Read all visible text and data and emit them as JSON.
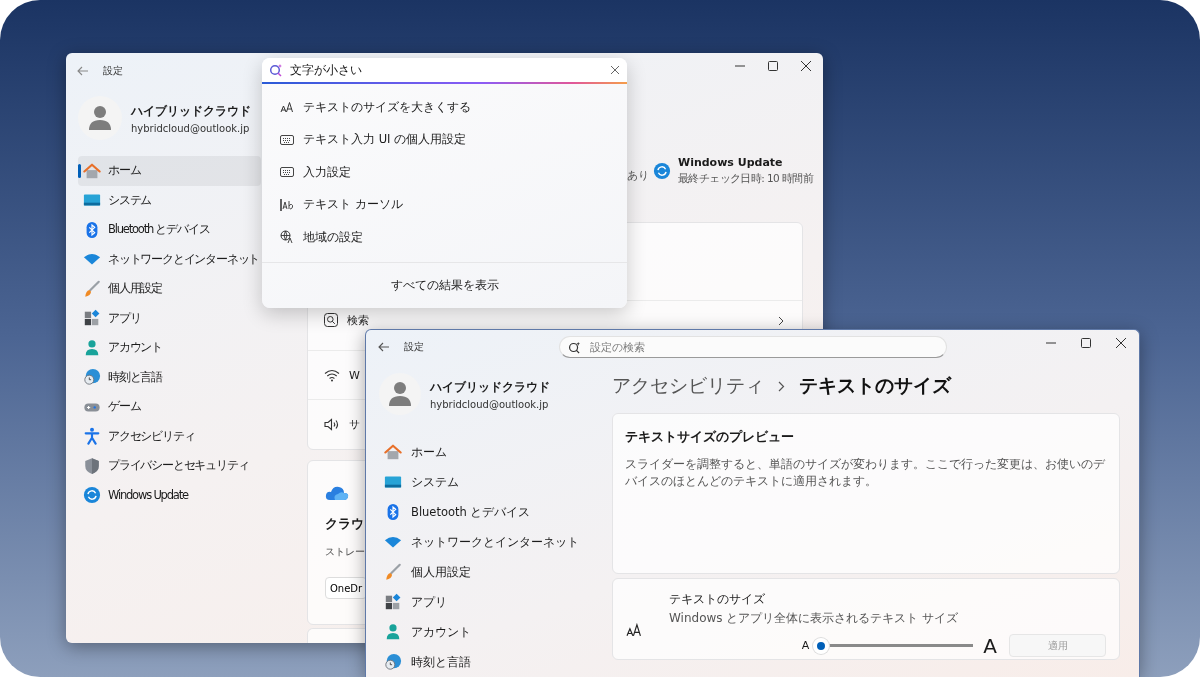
{
  "background_window": {
    "title": "設定",
    "search": {
      "value": "文字が小さい",
      "suggestions": [
        {
          "kind": "text-size",
          "label": "テキストのサイズを大きくする"
        },
        {
          "kind": "keyboard",
          "label": "テキスト入力 UI の個人用設定"
        },
        {
          "kind": "keyboard",
          "label": "入力設定"
        },
        {
          "kind": "cursor",
          "label": "テキスト カーソル"
        },
        {
          "kind": "region",
          "label": "地域の設定"
        }
      ],
      "show_all": "すべての結果を表示"
    },
    "profile": {
      "name": "ハイブリッドクラウド",
      "email": "hybridcloud@outlook.jp"
    },
    "nav": [
      {
        "label": "ホーム",
        "selected": true
      },
      {
        "label": "システム",
        "selected": false
      },
      {
        "label": "Bluetooth とデバイス",
        "selected": false
      },
      {
        "label": "ネットワークとインターネット",
        "selected": false
      },
      {
        "label": "個人用設定",
        "selected": false
      },
      {
        "label": "アプリ",
        "selected": false
      },
      {
        "label": "アカウント",
        "selected": false
      },
      {
        "label": "時刻と言語",
        "selected": false
      },
      {
        "label": "ゲーム",
        "selected": false
      },
      {
        "label": "アクセシビリティ",
        "selected": false
      },
      {
        "label": "プライバシーとセキュリティ",
        "selected": false
      },
      {
        "label": "Windows Update",
        "selected": false
      }
    ],
    "status_fragment": "あり",
    "update_tile": {
      "title": "Windows Update",
      "subtitle": "最終チェック日時: 10 時間前"
    },
    "rows": [
      {
        "kind": "search",
        "label": "検索"
      },
      {
        "kind": "wifi",
        "label": "W"
      },
      {
        "kind": "sound",
        "label": "サ"
      }
    ],
    "cloud_card": {
      "title": "クラウ",
      "text": "ストレー",
      "button": "OneDr"
    }
  },
  "front_window": {
    "title": "設定",
    "search": {
      "placeholder": "設定の検索"
    },
    "profile": {
      "name": "ハイブリッドクラウド",
      "email": "hybridcloud@outlook.jp"
    },
    "nav": [
      {
        "label": "ホーム",
        "selected": false
      },
      {
        "label": "システム",
        "selected": false
      },
      {
        "label": "Bluetooth とデバイス",
        "selected": false
      },
      {
        "label": "ネットワークとインターネット",
        "selected": false
      },
      {
        "label": "個人用設定",
        "selected": false
      },
      {
        "label": "アプリ",
        "selected": false
      },
      {
        "label": "アカウント",
        "selected": false
      },
      {
        "label": "時刻と言語",
        "selected": false
      }
    ],
    "breadcrumb": [
      "アクセシビリティ",
      "テキストのサイズ"
    ],
    "preview": {
      "title": "テキストサイズのプレビュー",
      "text": "スライダーを調整すると、単語のサイズが変わります。ここで行った変更は、お使いのデバイスのほとんどのテキストに適用されます。"
    },
    "text_size": {
      "title": "テキストのサイズ",
      "description": "Windows とアプリ全体に表示されるテキスト サイズ",
      "min_label": "A",
      "max_label": "A",
      "level": 0,
      "apply_button": {
        "label": "適用",
        "disabled": true
      }
    }
  }
}
